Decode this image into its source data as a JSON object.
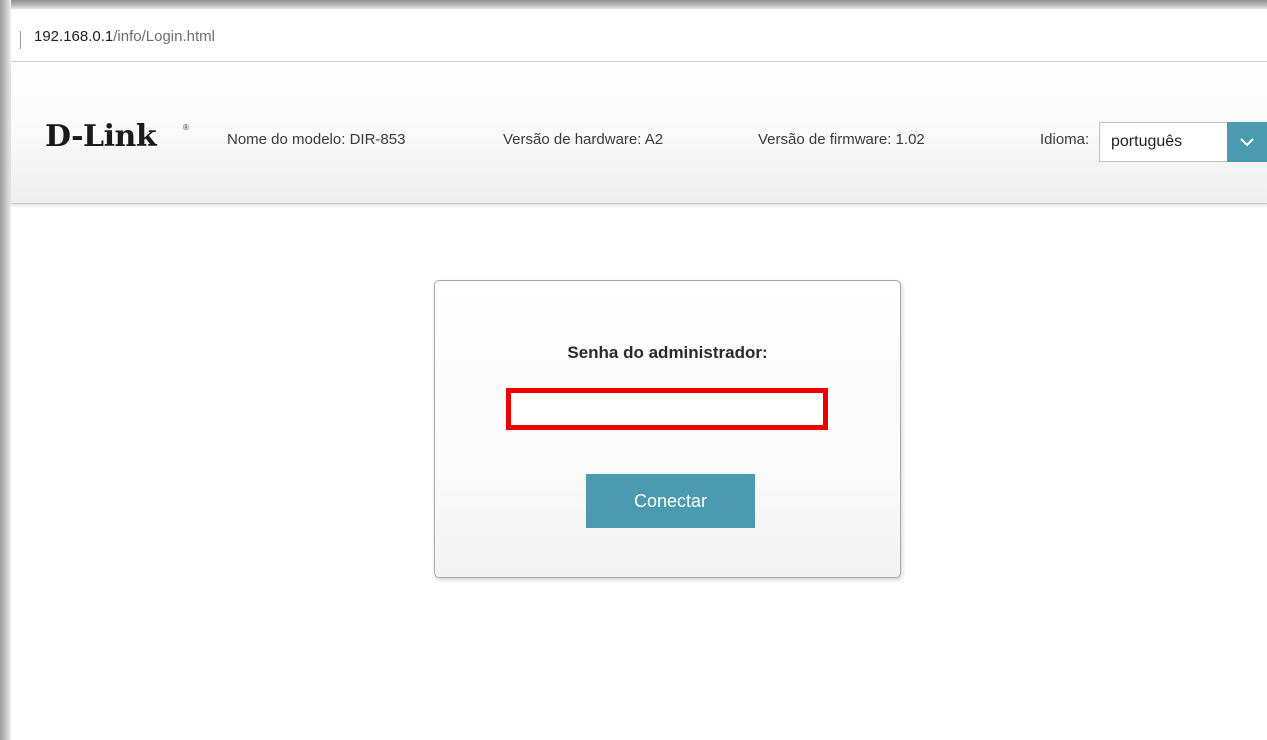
{
  "browser": {
    "address_host": "192.168.0.1",
    "address_path": "/info/Login.html"
  },
  "header": {
    "logo": "D-Link",
    "logo_mark": "®",
    "model": "Nome do modelo: DIR-853",
    "hardware": "Versão de hardware: A2",
    "firmware": "Versão de firmware: 1.02",
    "language_label": "Idioma:",
    "language_value": "português",
    "language_icon": "chevron-down-icon"
  },
  "login": {
    "password_label": "Senha do administrador:",
    "password_value": "",
    "connect_label": "Conectar"
  },
  "colors": {
    "accent": "#4a9bb0",
    "highlight_border": "#ee0000"
  }
}
